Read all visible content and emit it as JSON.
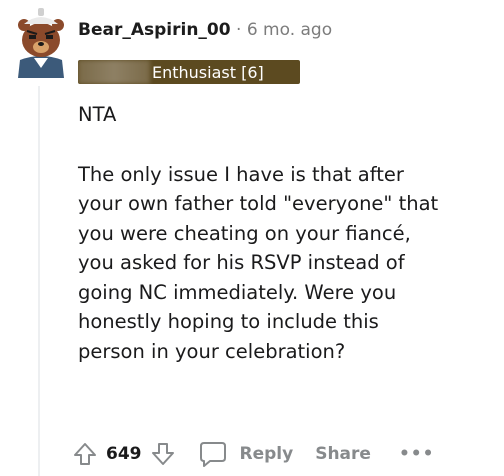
{
  "comment": {
    "username": "Bear_Aspirin_00",
    "separator": "·",
    "age": "6 mo. ago",
    "flair": "Enthusiast [6]",
    "body": {
      "paragraph1": "NTA",
      "paragraph2_lines": [
        "The only issue I have is that after",
        "your own father told \"everyone\" that",
        "you were cheating on your fiancé,",
        "you asked for his RSVP instead of",
        "going NC immediately. Were you",
        "honestly hoping to include this",
        "person in your celebration?"
      ]
    },
    "actions": {
      "vote_count": "649",
      "reply_label": "Reply",
      "share_label": "Share",
      "more_label": "•••"
    }
  },
  "colors": {
    "flair_bg": "#5c4a20",
    "meta_gray": "#7c7c7c",
    "action_gray": "#878a8c"
  },
  "icons": [
    "avatar-bear-icon",
    "upvote-icon",
    "downvote-icon",
    "comment-bubble-icon",
    "more-icon"
  ]
}
